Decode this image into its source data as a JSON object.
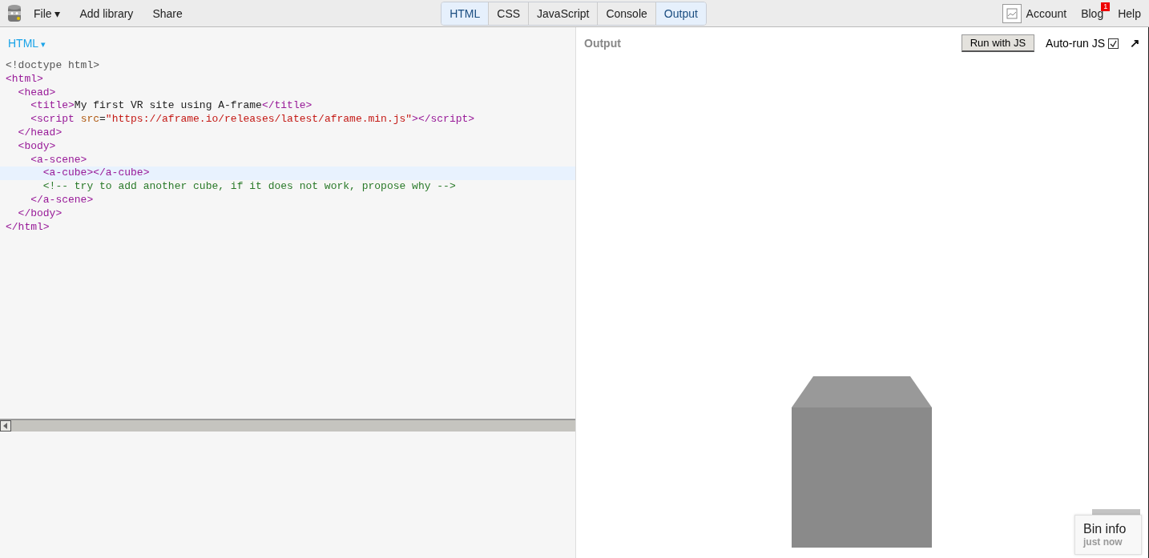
{
  "topbar": {
    "menu": [
      {
        "label": "File",
        "caret": "▾"
      },
      {
        "label": "Add library"
      },
      {
        "label": "Share"
      }
    ],
    "panel_tabs": [
      {
        "label": "HTML",
        "selected": true
      },
      {
        "label": "CSS",
        "selected": false
      },
      {
        "label": "JavaScript",
        "selected": false
      },
      {
        "label": "Console",
        "selected": false
      },
      {
        "label": "Output",
        "selected": true
      }
    ],
    "right": [
      {
        "label": "Account"
      },
      {
        "label": "Blog",
        "badge": "1"
      },
      {
        "label": "Help"
      }
    ]
  },
  "editor": {
    "title": "HTML",
    "caret": "▾",
    "lines": [
      {
        "active": false,
        "tokens": [
          {
            "kind": "doctype",
            "text": "<!doctype html>"
          }
        ]
      },
      {
        "active": false,
        "tokens": [
          {
            "kind": "tag",
            "text": "<html>"
          }
        ]
      },
      {
        "active": false,
        "tokens": [
          {
            "kind": "tag",
            "text": "  <head>"
          }
        ]
      },
      {
        "active": false,
        "tokens": [
          {
            "kind": "tag",
            "text": "    <title>"
          },
          {
            "kind": "text",
            "text": "My first VR site using A-frame"
          },
          {
            "kind": "tag",
            "text": "</title>"
          }
        ]
      },
      {
        "active": false,
        "tokens": [
          {
            "kind": "tag",
            "text": "    <script "
          },
          {
            "kind": "attr",
            "text": "src"
          },
          {
            "kind": "text",
            "text": "="
          },
          {
            "kind": "string",
            "text": "\"https://aframe.io/releases/latest/aframe.min.js\""
          },
          {
            "kind": "tag",
            "text": "></script>"
          }
        ]
      },
      {
        "active": false,
        "tokens": [
          {
            "kind": "tag",
            "text": "  </head>"
          }
        ]
      },
      {
        "active": false,
        "tokens": [
          {
            "kind": "tag",
            "text": "  <body>"
          }
        ]
      },
      {
        "active": false,
        "tokens": [
          {
            "kind": "tag",
            "text": "    <a-scene>"
          }
        ]
      },
      {
        "active": true,
        "tokens": [
          {
            "kind": "tag",
            "text": "      <a-cube></a-cube>"
          }
        ]
      },
      {
        "active": false,
        "tokens": [
          {
            "kind": "comment",
            "text": "      <!-- try to add another cube, if it does not work, propose why -->"
          }
        ]
      },
      {
        "active": false,
        "tokens": [
          {
            "kind": "tag",
            "text": "    </a-scene>"
          }
        ]
      },
      {
        "active": false,
        "tokens": [
          {
            "kind": "tag",
            "text": "  </body>"
          }
        ]
      },
      {
        "active": false,
        "tokens": [
          {
            "kind": "tag",
            "text": "</html>"
          }
        ]
      }
    ]
  },
  "output": {
    "title": "Output",
    "run_button": "Run with JS",
    "autorun": {
      "label": "Auto-run JS",
      "checked": true
    },
    "popout": "↗"
  },
  "bin_info": {
    "title": "Bin info",
    "time": "just now"
  }
}
